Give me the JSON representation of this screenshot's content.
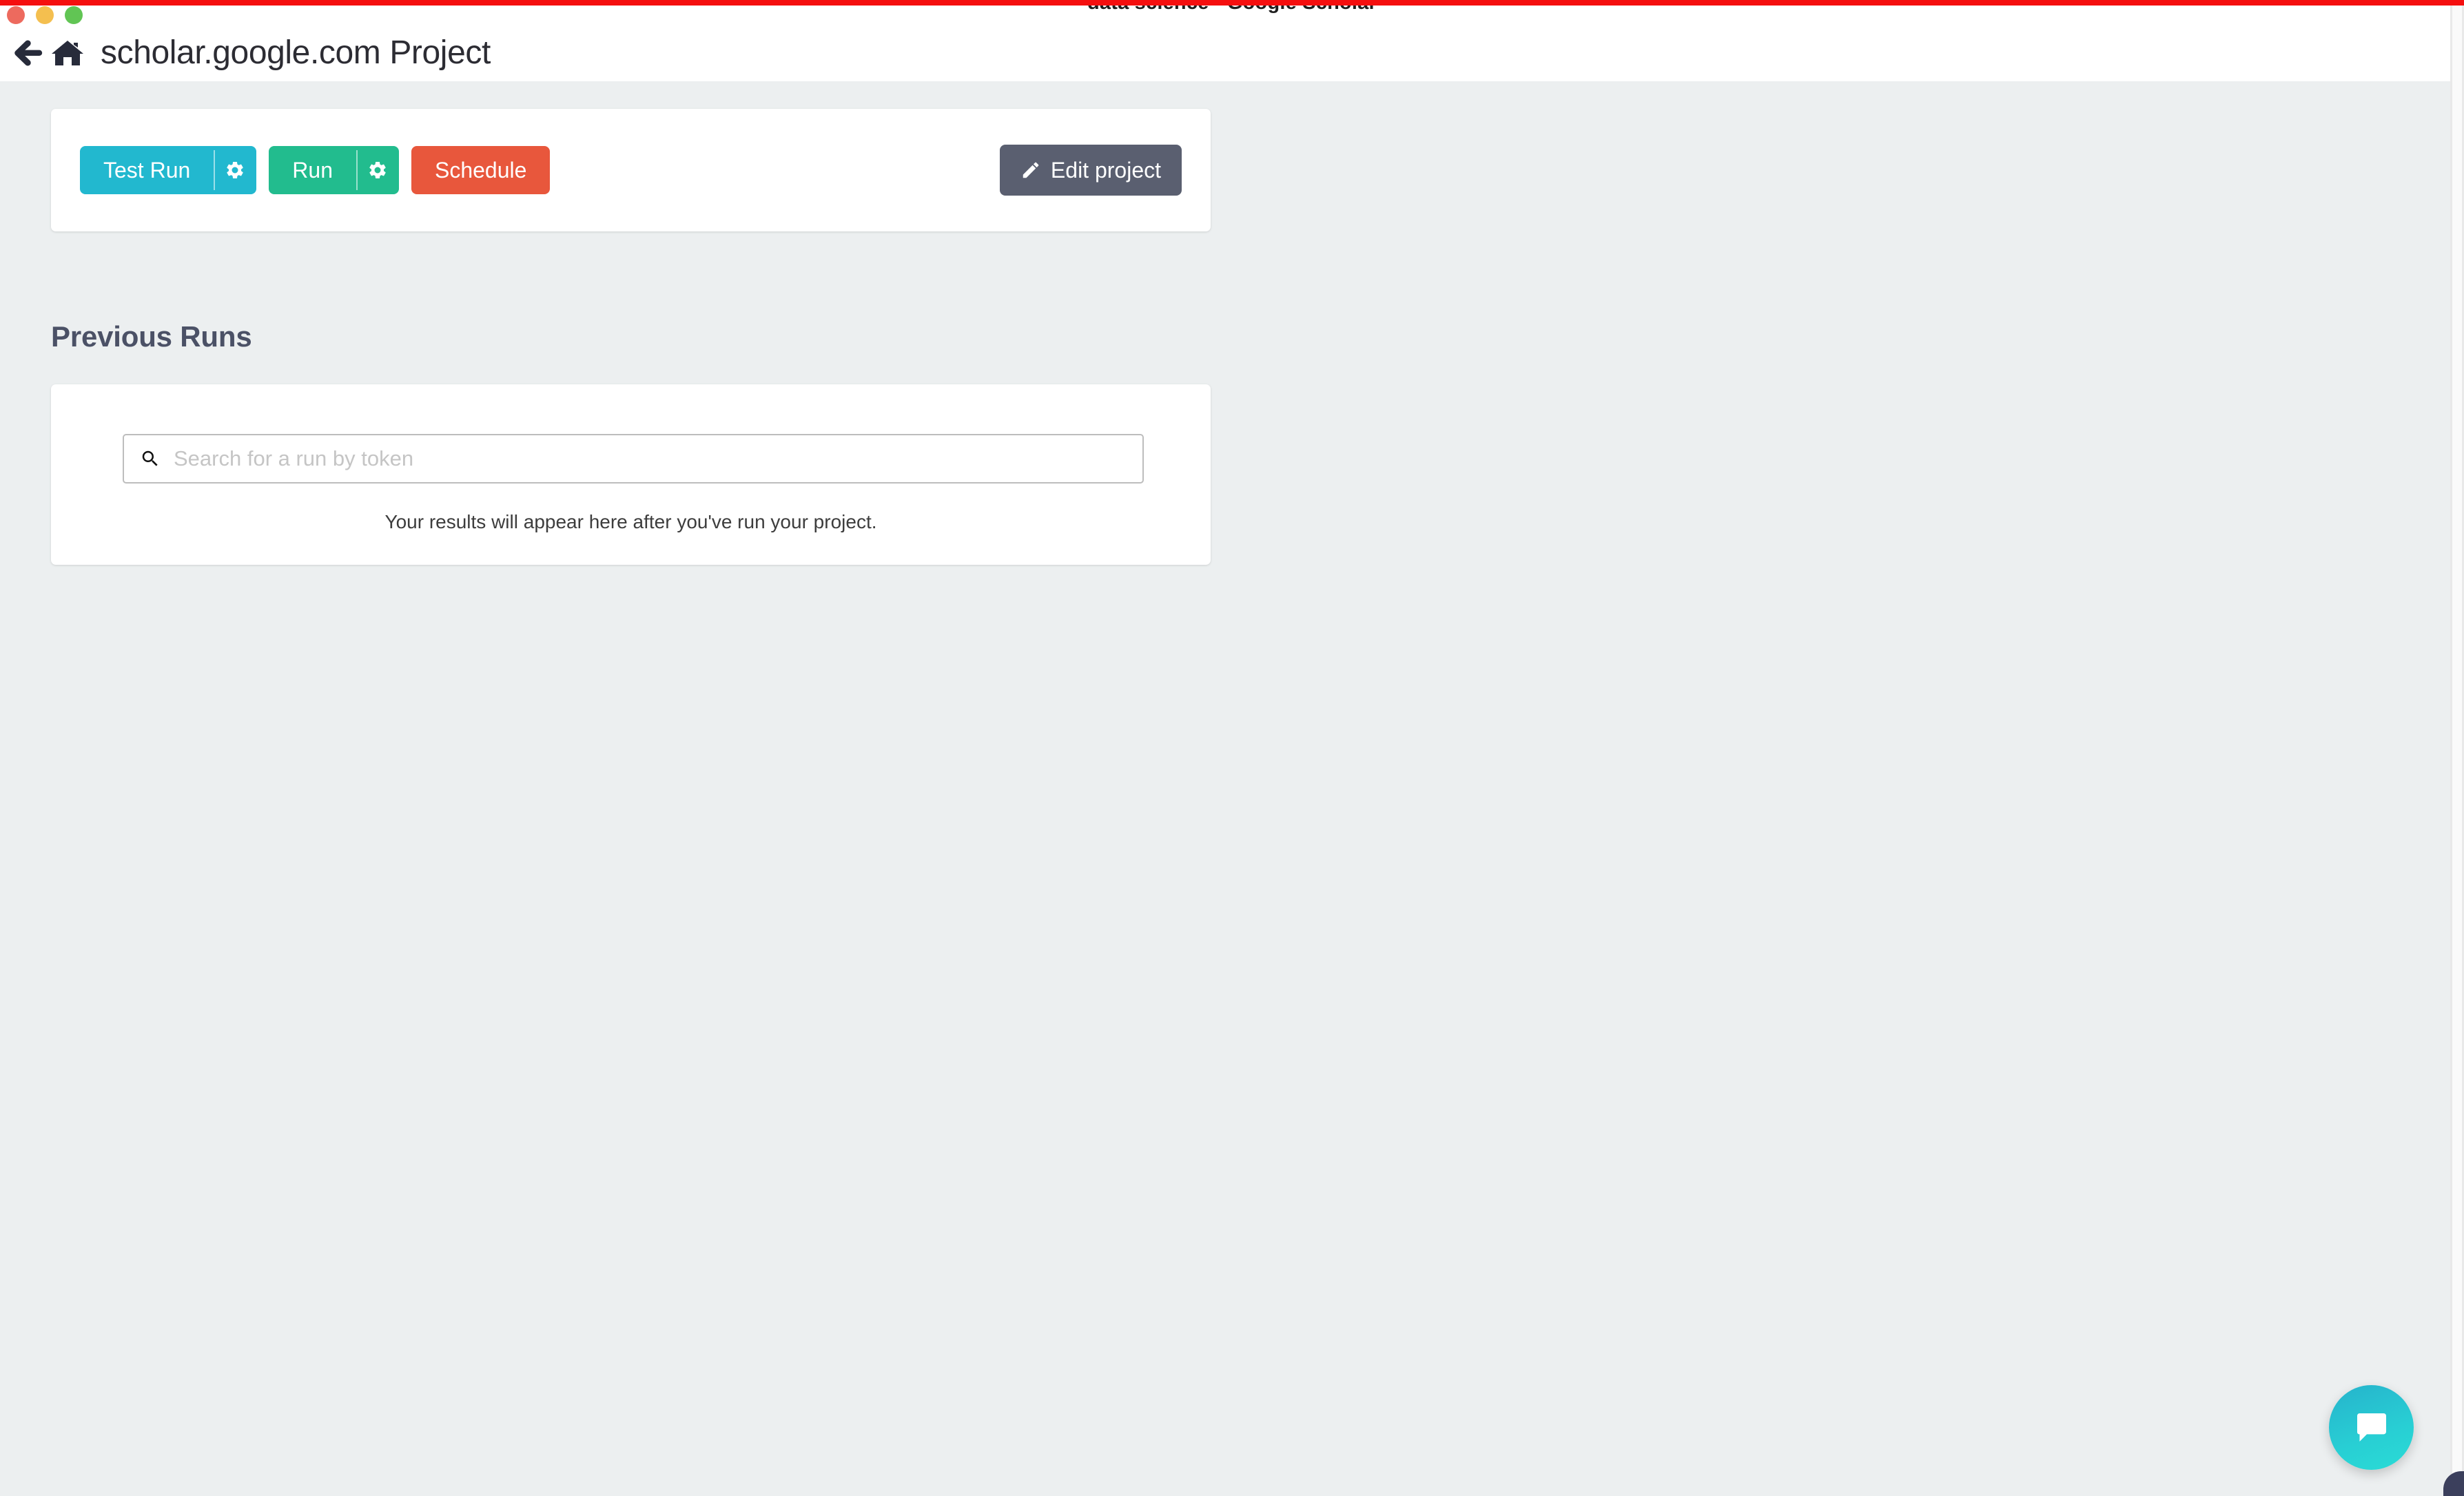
{
  "window": {
    "title": "data science - Google Scholar",
    "accent_bar_color": "#f50f0f",
    "traffic_lights": [
      {
        "name": "close",
        "color": "#ed6a5e"
      },
      {
        "name": "minimize",
        "color": "#f4bf4f"
      },
      {
        "name": "zoom",
        "color": "#61c554"
      }
    ]
  },
  "navbar": {
    "back_icon": "back-arrow-icon",
    "home_icon": "home-icon",
    "title": "scholar.google.com Project"
  },
  "toolbar": {
    "test_run_label": "Test Run",
    "test_run_settings_icon": "gear-icon",
    "test_run_color": "#22b8cf",
    "run_label": "Run",
    "run_settings_icon": "gear-icon",
    "run_color": "#22bc8e",
    "schedule_label": "Schedule",
    "schedule_color": "#e8573c",
    "edit_project_label": "Edit project",
    "edit_project_icon": "pencil-icon",
    "edit_project_color": "#5a5f70"
  },
  "previous_runs": {
    "heading": "Previous Runs",
    "search_placeholder": "Search for a run by token",
    "search_value": "",
    "search_icon": "search-icon",
    "empty_message": "Your results will appear here after you've run your project."
  },
  "chat": {
    "icon": "chat-bubble-icon",
    "color": "#28cfd4"
  },
  "page": {
    "background_color": "#eceff0",
    "card_background_color": "#ffffff"
  }
}
